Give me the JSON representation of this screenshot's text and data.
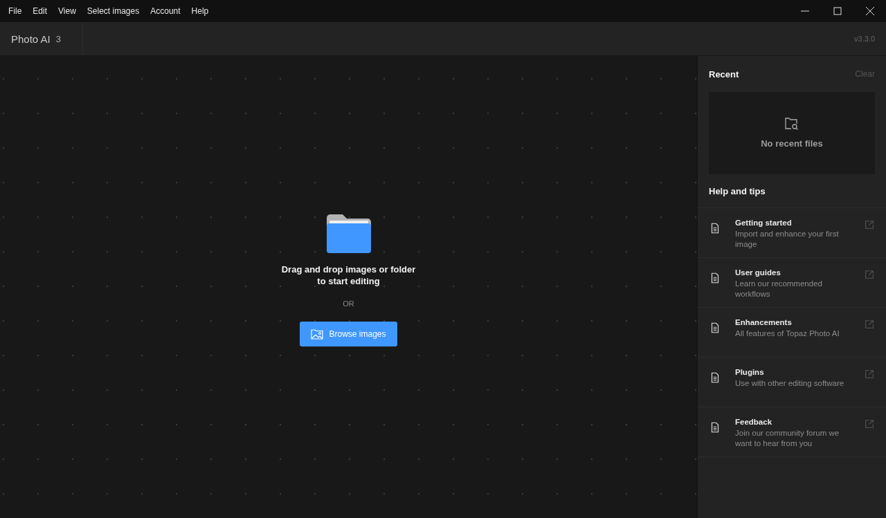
{
  "menu": [
    "File",
    "Edit",
    "View",
    "Select images",
    "Account",
    "Help"
  ],
  "app": {
    "name": "Photo AI",
    "version_number": "3",
    "version": "v3.3.0"
  },
  "dropzone": {
    "message": "Drag and drop images or folder\nto start editing",
    "separator": "OR",
    "button": "Browse images"
  },
  "recent": {
    "title": "Recent",
    "clear": "Clear",
    "empty": "No recent files"
  },
  "help": {
    "title": "Help and tips",
    "items": [
      {
        "title": "Getting started",
        "description": "Import and enhance your first image"
      },
      {
        "title": "User guides",
        "description": "Learn our recommended workflows"
      },
      {
        "title": "Enhancements",
        "description": "All features of Topaz Photo AI"
      },
      {
        "title": "Plugins",
        "description": "Use with other editing software"
      },
      {
        "title": "Feedback",
        "description": "Join our community forum we want to hear from you"
      }
    ]
  }
}
